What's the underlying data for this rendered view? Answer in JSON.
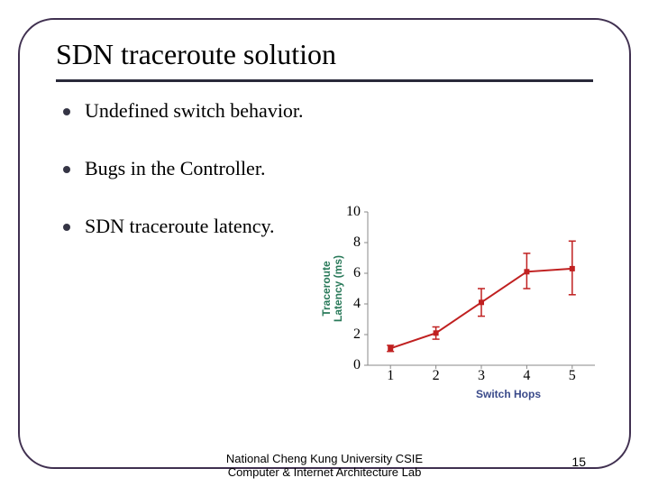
{
  "title": "SDN traceroute solution",
  "bullets": [
    "Undefined switch behavior.",
    "Bugs in the Controller.",
    "SDN traceroute latency."
  ],
  "footer_line1": "National Cheng Kung University CSIE",
  "footer_line2": "Computer & Internet Architecture Lab",
  "page_number": "15",
  "chart_data": {
    "type": "line",
    "xlabel": "Switch Hops",
    "ylabel": "Traceroute\nLatency (ms)",
    "xticks": [
      1,
      2,
      3,
      4,
      5
    ],
    "yticks": [
      0,
      2,
      4,
      6,
      8,
      10
    ],
    "xlim": [
      0.5,
      5.5
    ],
    "ylim": [
      0,
      10
    ],
    "series": [
      {
        "name": "latency",
        "x": [
          1,
          2,
          3,
          4,
          5
        ],
        "y": [
          1.1,
          2.1,
          4.1,
          6.1,
          6.3
        ],
        "err_low": [
          0.9,
          1.7,
          3.2,
          5.0,
          4.6
        ],
        "err_high": [
          1.3,
          2.5,
          5.0,
          7.3,
          8.1
        ]
      }
    ]
  }
}
